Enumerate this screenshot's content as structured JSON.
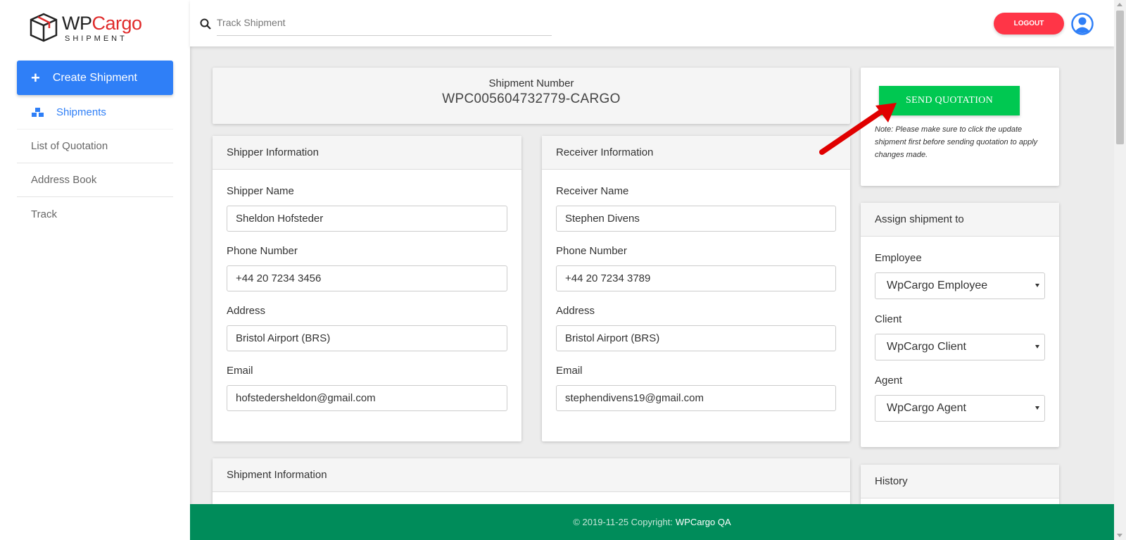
{
  "logo": {
    "wp": "WP",
    "cargo": "Cargo",
    "sub": "SHIPMENT"
  },
  "sidebar": {
    "create_label": "Create Shipment",
    "items": [
      {
        "label": "Shipments"
      },
      {
        "label": "List of Quotation"
      },
      {
        "label": "Address Book"
      },
      {
        "label": "Track"
      }
    ]
  },
  "header": {
    "search_placeholder": "Track Shipment",
    "logout_label": "LOGOUT"
  },
  "shipment": {
    "number_label": "Shipment Number",
    "number_value": "WPC005604732779-CARGO"
  },
  "shipper": {
    "title": "Shipper Information",
    "name_label": "Shipper Name",
    "name_value": "Sheldon Hofsteder",
    "phone_label": "Phone Number",
    "phone_value": "+44 20 7234 3456",
    "address_label": "Address",
    "address_value": "Bristol Airport (BRS)",
    "email_label": "Email",
    "email_value": "hofstedersheldon@gmail.com"
  },
  "receiver": {
    "title": "Receiver Information",
    "name_label": "Receiver Name",
    "name_value": "Stephen Divens",
    "phone_label": "Phone Number",
    "phone_value": "+44 20 7234 3789",
    "address_label": "Address",
    "address_value": "Bristol Airport (BRS)",
    "email_label": "Email",
    "email_value": "stephendivens19@gmail.com"
  },
  "quotation": {
    "send_label": "SEND QUOTATION",
    "note": "Note: Please make sure to click the update shipment first before sending quotation to apply changes made."
  },
  "assign": {
    "title": "Assign shipment to",
    "employee_label": "Employee",
    "employee_value": "WpCargo Employee",
    "client_label": "Client",
    "client_value": "WpCargo Client",
    "agent_label": "Agent",
    "agent_value": "WpCargo Agent"
  },
  "shipment_info": {
    "title": "Shipment Information"
  },
  "history": {
    "title": "History"
  },
  "footer": {
    "copyright": "© 2019-11-25 Copyright:",
    "brand": "WPCargo QA"
  },
  "colors": {
    "primary": "#2f7ff7",
    "logout": "#ff3547",
    "send": "#00c851",
    "footer": "#008c5a",
    "arrow": "#e00000"
  }
}
